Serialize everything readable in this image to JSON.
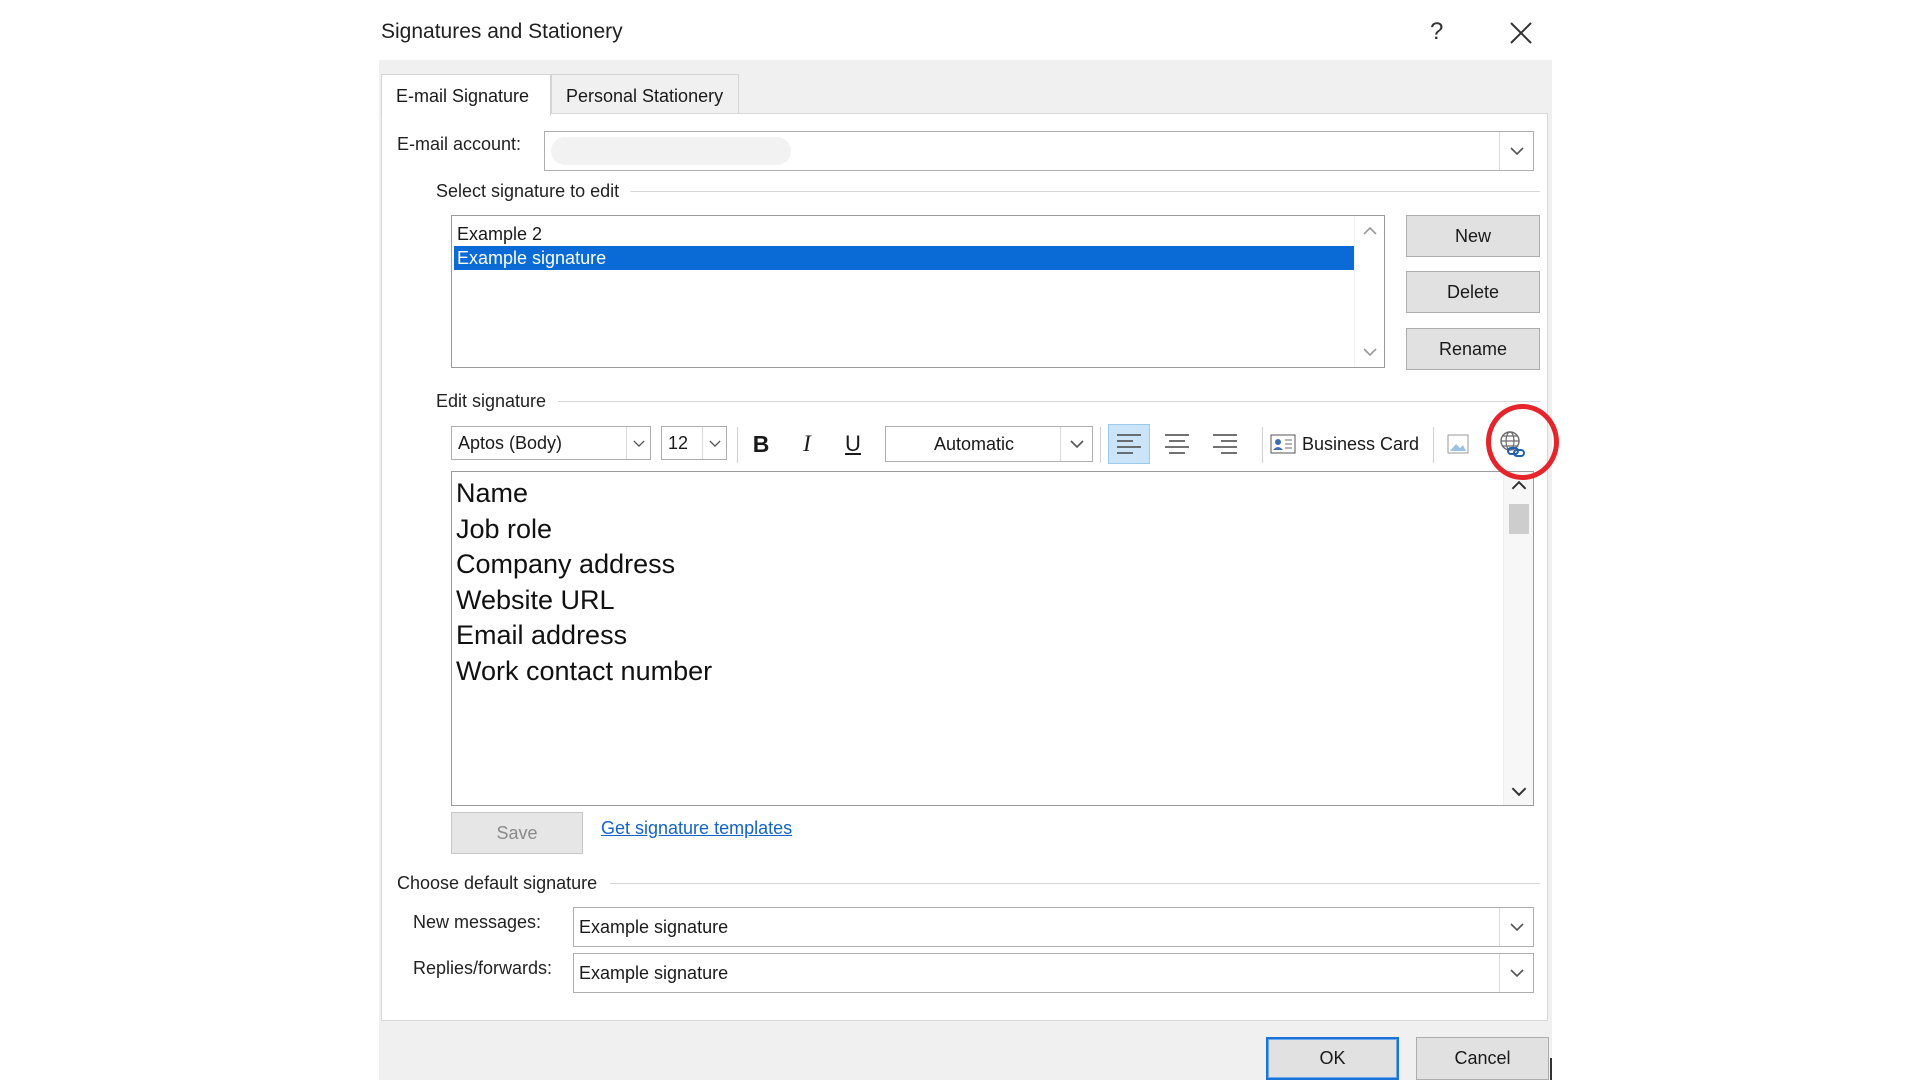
{
  "dialog": {
    "title": "Signatures and Stationery",
    "help_label": "?"
  },
  "tabs": [
    {
      "label": "E-mail Signature",
      "active": true
    },
    {
      "label": "Personal Stationery",
      "active": false
    }
  ],
  "email_account": {
    "label": "E-mail account:",
    "value": ""
  },
  "select_signature": {
    "section_label": "Select signature to edit",
    "items": [
      {
        "label": "Example 2",
        "selected": false
      },
      {
        "label": "Example signature",
        "selected": true
      }
    ],
    "buttons": {
      "new": "New",
      "delete": "Delete",
      "rename": "Rename"
    }
  },
  "edit_signature": {
    "section_label": "Edit signature",
    "toolbar": {
      "font": "Aptos (Body)",
      "size": "12",
      "bold": "B",
      "italic": "I",
      "underline": "U",
      "color": "Automatic",
      "business_card": "Business Card"
    },
    "lines": [
      "Name",
      "Job role",
      "Company address",
      "Website URL",
      "Email address",
      "Work contact number"
    ],
    "save_label": "Save",
    "templates_link": "Get signature templates"
  },
  "default_signature": {
    "section_label": "Choose default signature",
    "new_messages_label": "New messages:",
    "new_messages_value": "Example signature",
    "replies_label": "Replies/forwards:",
    "replies_value": "Example signature"
  },
  "footer": {
    "ok": "OK",
    "cancel": "Cancel"
  },
  "colors": {
    "selection": "#0a6ad6",
    "highlight_ring": "#e5242b",
    "link": "#1463c8"
  }
}
